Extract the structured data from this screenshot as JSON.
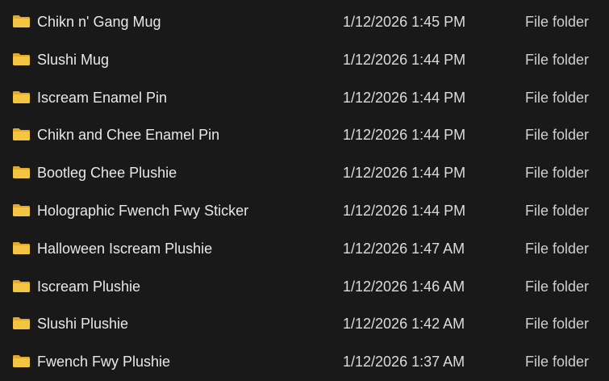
{
  "colors": {
    "background": "#191919",
    "folder_body": "#f4c542",
    "folder_tab": "#e3a92a",
    "text": "#e8e8e8"
  },
  "rows": [
    {
      "icon": "folder-icon",
      "name": "Chikn n' Gang Mug",
      "date_modified": "1/12/2026 1:45 PM",
      "type": "File folder"
    },
    {
      "icon": "folder-icon",
      "name": "Slushi Mug",
      "date_modified": "1/12/2026 1:44 PM",
      "type": "File folder"
    },
    {
      "icon": "folder-icon",
      "name": "Iscream Enamel Pin",
      "date_modified": "1/12/2026 1:44 PM",
      "type": "File folder"
    },
    {
      "icon": "folder-icon",
      "name": "Chikn and Chee Enamel Pin",
      "date_modified": "1/12/2026 1:44 PM",
      "type": "File folder"
    },
    {
      "icon": "folder-icon",
      "name": "Bootleg Chee Plushie",
      "date_modified": "1/12/2026 1:44 PM",
      "type": "File folder"
    },
    {
      "icon": "folder-icon",
      "name": "Holographic Fwench Fwy Sticker",
      "date_modified": "1/12/2026 1:44 PM",
      "type": "File folder"
    },
    {
      "icon": "folder-icon",
      "name": "Halloween Iscream Plushie",
      "date_modified": "1/12/2026 1:47 AM",
      "type": "File folder"
    },
    {
      "icon": "folder-icon",
      "name": "Iscream Plushie",
      "date_modified": "1/12/2026 1:46 AM",
      "type": "File folder"
    },
    {
      "icon": "folder-icon",
      "name": "Slushi Plushie",
      "date_modified": "1/12/2026 1:42 AM",
      "type": "File folder"
    },
    {
      "icon": "folder-icon",
      "name": "Fwench Fwy Plushie",
      "date_modified": "1/12/2026 1:37 AM",
      "type": "File folder"
    }
  ]
}
